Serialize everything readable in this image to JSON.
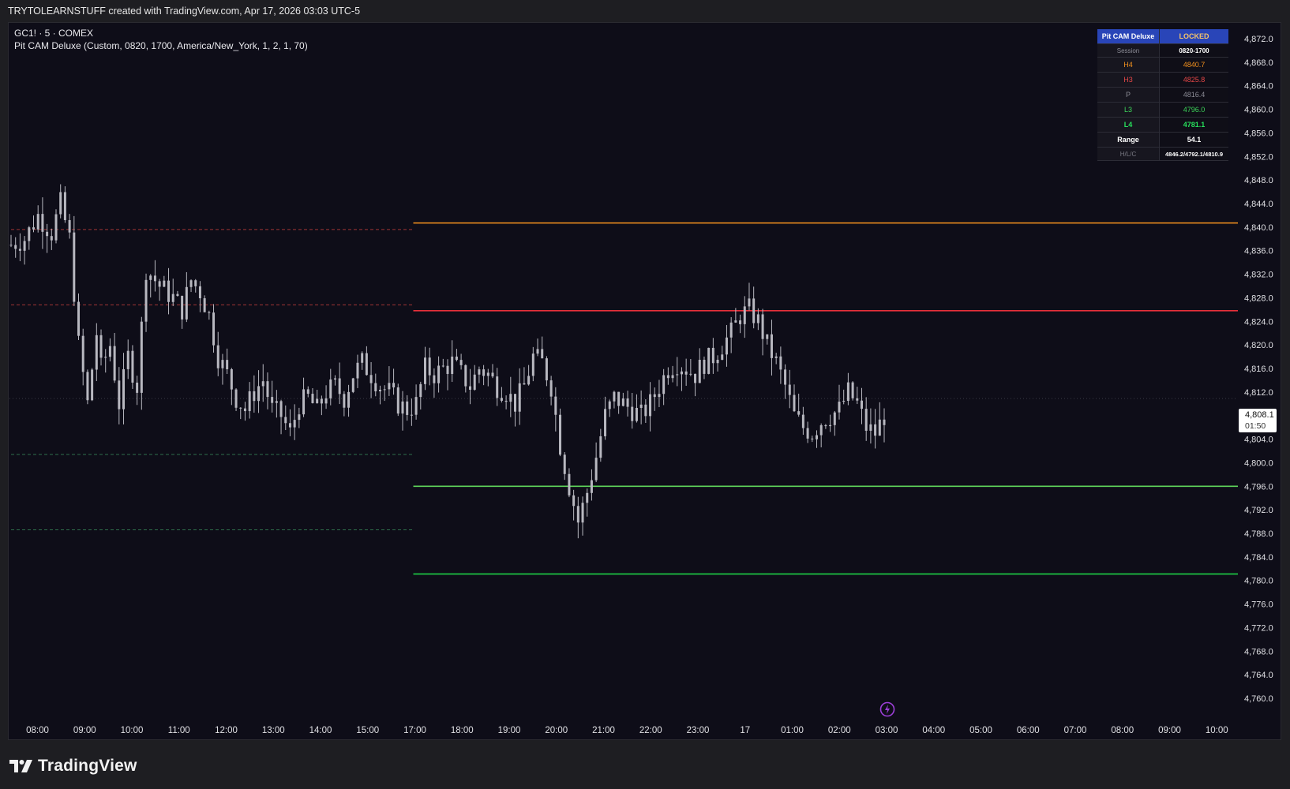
{
  "header": {
    "credit": "TRYTOLEARNSTUFF created with TradingView.com, Apr 17, 2026 03:03 UTC-5"
  },
  "legend": {
    "symbol_line": "GC1! · 5 · COMEX",
    "indicator_line": "Pit CAM Deluxe (Custom, 0820, 1700, America/New_York, 1, 2, 1, 70)"
  },
  "info_table": {
    "header": {
      "label": "Pit CAM Deluxe",
      "value": "LOCKED"
    },
    "rows": [
      {
        "label": "Session",
        "value": "0820-1700",
        "color": "#8c8c96"
      },
      {
        "label": "H4",
        "value": "4840.7",
        "color": "#f7931e"
      },
      {
        "label": "H3",
        "value": "4825.8",
        "color": "#e84848"
      },
      {
        "label": "P",
        "value": "4816.4",
        "color": "#8c8c96"
      },
      {
        "label": "L3",
        "value": "4796.0",
        "color": "#3dd65a"
      },
      {
        "label": "L4",
        "value": "4781.1",
        "color": "#27e05c"
      },
      {
        "label": "Range",
        "value": "54.1",
        "color": "#ffffff"
      },
      {
        "label": "H/L/C",
        "value": "4846.2/4792.1/4810.9",
        "color": "#7a7a84"
      }
    ]
  },
  "price_tag": {
    "price": "4,808.1",
    "countdown": "01:50"
  },
  "brand": {
    "name": "TradingView"
  },
  "colors": {
    "background": "#0e0d18",
    "candle": "#b8b8c0",
    "h4": "#f7931e",
    "h3": "#e8303a",
    "l3": "#5fd45a",
    "l4": "#1ee04a",
    "grid_dot": "#3a3a46"
  },
  "chart_data": {
    "type": "candlestick",
    "interval_minutes": 5,
    "y_axis": {
      "ylim": [
        4757.0,
        4874.0
      ],
      "ticks": [
        4872.0,
        4868.0,
        4864.0,
        4860.0,
        4856.0,
        4852.0,
        4848.0,
        4844.0,
        4840.0,
        4836.0,
        4832.0,
        4828.0,
        4824.0,
        4820.0,
        4816.0,
        4812.0,
        4808.0,
        4804.0,
        4800.0,
        4796.0,
        4792.0,
        4788.0,
        4784.0,
        4780.0,
        4776.0,
        4772.0,
        4768.0,
        4764.0,
        4760.0
      ]
    },
    "x_axis": {
      "ticks": [
        "08:00",
        "09:00",
        "10:00",
        "11:00",
        "12:00",
        "13:00",
        "14:00",
        "15:00",
        "17:00",
        "18:00",
        "19:00",
        "20:00",
        "21:00",
        "22:00",
        "23:00",
        "17",
        "01:00",
        "02:00",
        "03:00",
        "04:00",
        "05:00",
        "06:00",
        "07:00",
        "08:00",
        "09:00",
        "10:00"
      ]
    },
    "previous_session_levels": [
      {
        "name": "H4",
        "value": 4839.6,
        "color": "#a03434"
      },
      {
        "name": "H3",
        "value": 4826.8,
        "color": "#a03434"
      },
      {
        "name": "L3",
        "value": 4801.4,
        "color": "#2f6f4c"
      },
      {
        "name": "L4",
        "value": 4788.6,
        "color": "#2f6f4c"
      }
    ],
    "levels": [
      {
        "name": "H4",
        "value": 4840.7,
        "color": "#f7931e"
      },
      {
        "name": "H3",
        "value": 4825.8,
        "color": "#e8303a"
      },
      {
        "name": "L3",
        "value": 4796.0,
        "color": "#5fd45a"
      },
      {
        "name": "L4",
        "value": 4781.1,
        "color": "#1ee04a"
      }
    ],
    "prior_close": 4810.9,
    "last_price": 4808.1,
    "path": [
      [
        0,
        4837
      ],
      [
        3,
        4838
      ],
      [
        6,
        4842
      ],
      [
        9,
        4839
      ],
      [
        11,
        4844
      ],
      [
        13,
        4838
      ],
      [
        15,
        4820
      ],
      [
        17,
        4810
      ],
      [
        19,
        4822
      ],
      [
        20,
        4816
      ],
      [
        22,
        4820
      ],
      [
        24,
        4810
      ],
      [
        26,
        4818
      ],
      [
        28,
        4813
      ],
      [
        30,
        4833
      ],
      [
        33,
        4830
      ],
      [
        36,
        4828
      ],
      [
        38,
        4826
      ],
      [
        40,
        4831
      ],
      [
        42,
        4829
      ],
      [
        44,
        4825
      ],
      [
        46,
        4818
      ],
      [
        48,
        4815
      ],
      [
        50,
        4811
      ],
      [
        52,
        4809
      ],
      [
        54,
        4812
      ],
      [
        56,
        4814
      ],
      [
        58,
        4809
      ],
      [
        60,
        4808
      ],
      [
        62,
        4805
      ],
      [
        64,
        4810
      ],
      [
        66,
        4811
      ],
      [
        68,
        4809
      ],
      [
        70,
        4812
      ],
      [
        72,
        4813
      ],
      [
        74,
        4811
      ],
      [
        76,
        4815
      ],
      [
        78,
        4817
      ],
      [
        80,
        4815
      ],
      [
        82,
        4813
      ],
      [
        84,
        4812
      ],
      [
        86,
        4810
      ],
      [
        88,
        4809
      ],
      [
        90,
        4810
      ],
      [
        92,
        4816
      ],
      [
        94,
        4815
      ],
      [
        96,
        4816
      ],
      [
        98,
        4817
      ],
      [
        100,
        4815
      ],
      [
        102,
        4813
      ],
      [
        104,
        4816
      ],
      [
        106,
        4815
      ],
      [
        108,
        4813
      ],
      [
        110,
        4812
      ],
      [
        112,
        4810
      ],
      [
        114,
        4813
      ],
      [
        116,
        4818
      ],
      [
        118,
        4817
      ],
      [
        120,
        4813
      ],
      [
        122,
        4803
      ],
      [
        124,
        4796
      ],
      [
        126,
        4790
      ],
      [
        128,
        4795
      ],
      [
        130,
        4801
      ],
      [
        132,
        4808
      ],
      [
        134,
        4811
      ],
      [
        136,
        4810
      ],
      [
        138,
        4809
      ],
      [
        140,
        4808
      ],
      [
        142,
        4810
      ],
      [
        144,
        4813
      ],
      [
        146,
        4816
      ],
      [
        148,
        4817
      ],
      [
        150,
        4816
      ],
      [
        152,
        4815
      ],
      [
        154,
        4817
      ],
      [
        156,
        4818
      ],
      [
        158,
        4820
      ],
      [
        160,
        4822
      ],
      [
        162,
        4825
      ],
      [
        164,
        4826
      ],
      [
        166,
        4824
      ],
      [
        168,
        4820
      ],
      [
        170,
        4817
      ],
      [
        172,
        4813
      ],
      [
        174,
        4808
      ],
      [
        176,
        4806
      ],
      [
        178,
        4805
      ],
      [
        180,
        4807
      ],
      [
        182,
        4808
      ],
      [
        184,
        4809
      ],
      [
        186,
        4812
      ],
      [
        188,
        4810
      ],
      [
        190,
        4806
      ],
      [
        192,
        4805
      ],
      [
        194,
        4808
      ]
    ]
  }
}
